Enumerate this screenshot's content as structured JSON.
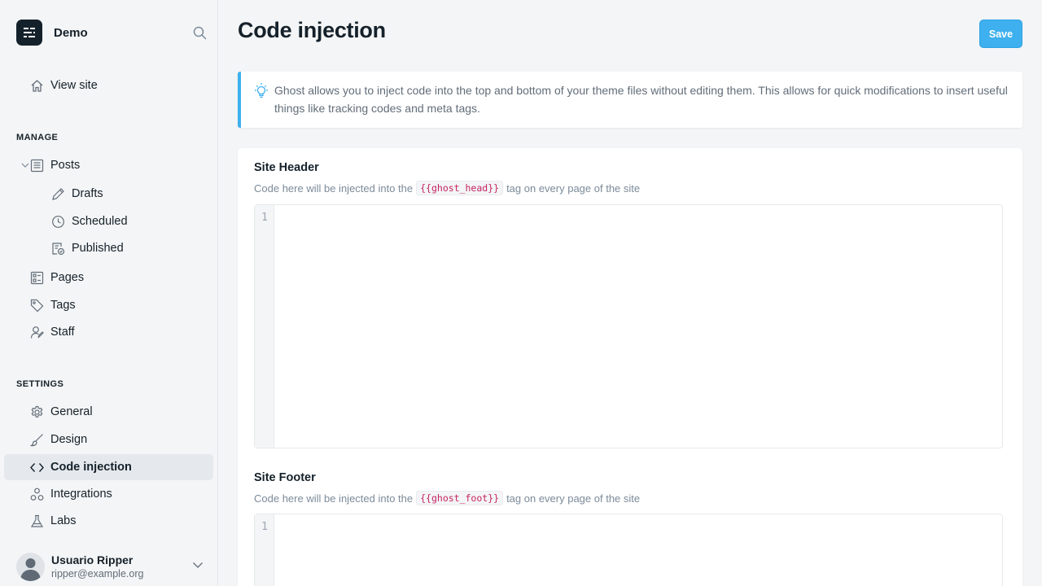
{
  "app": {
    "site_name": "Demo"
  },
  "sidebar": {
    "view_site": "View site",
    "manage_heading": "MANAGE",
    "manage_items": [
      {
        "label": "Posts",
        "icon": "posts-icon"
      },
      {
        "label": "Drafts",
        "icon": "pencil-icon"
      },
      {
        "label": "Scheduled",
        "icon": "clock-icon"
      },
      {
        "label": "Published",
        "icon": "published-icon"
      },
      {
        "label": "Pages",
        "icon": "pages-icon"
      },
      {
        "label": "Tags",
        "icon": "tag-icon"
      },
      {
        "label": "Staff",
        "icon": "staff-icon"
      }
    ],
    "settings_heading": "SETTINGS",
    "settings_items": [
      {
        "label": "General",
        "icon": "gear-icon"
      },
      {
        "label": "Design",
        "icon": "brush-icon"
      },
      {
        "label": "Code injection",
        "icon": "code-icon",
        "active": true
      },
      {
        "label": "Integrations",
        "icon": "integrations-icon"
      },
      {
        "label": "Labs",
        "icon": "flask-icon"
      }
    ],
    "user": {
      "name": "Usuario Ripper",
      "email": "ripper@example.org"
    }
  },
  "main": {
    "title": "Code injection",
    "save_label": "Save",
    "info_text": "Ghost allows you to inject code into the top and bottom of your theme files without editing them. This allows for quick modifications to insert useful things like tracking codes and meta tags.",
    "header_section": {
      "title": "Site Header",
      "desc_before": "Code here will be injected into the",
      "code": "{{ghost_head}}",
      "desc_after": "tag on every page of the site",
      "line_number": "1"
    },
    "footer_section": {
      "title": "Site Footer",
      "desc_before": "Code here will be injected into the",
      "code": "{{ghost_foot}}",
      "desc_after": "tag on every page of the site",
      "line_number": "1"
    }
  },
  "colors": {
    "accent": "#3eb0ef",
    "code_text": "#c5245f",
    "active_bg": "#e5e9ed"
  }
}
